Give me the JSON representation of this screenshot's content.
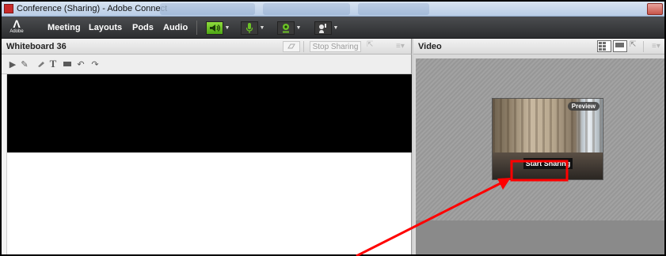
{
  "window": {
    "title": "Conference (Sharing) - Adobe Connect"
  },
  "menubar": {
    "logo_word": "Adobe",
    "items": [
      "Meeting",
      "Layouts",
      "Pods",
      "Audio"
    ]
  },
  "whiteboard": {
    "title": "Whiteboard 36",
    "stop_sharing_label": "Stop Sharing",
    "tools": [
      "pointer-tool",
      "pencil-tool",
      "eraser-tool",
      "text-tool",
      "shape-tool",
      "undo-tool",
      "redo-tool"
    ]
  },
  "video": {
    "title": "Video",
    "preview_label": "Preview",
    "start_sharing_label": "Start Sharing"
  },
  "colors": {
    "annotation": "#ff0000",
    "menubar": "#3a3b3d",
    "toggle_active": "#6cc227"
  }
}
